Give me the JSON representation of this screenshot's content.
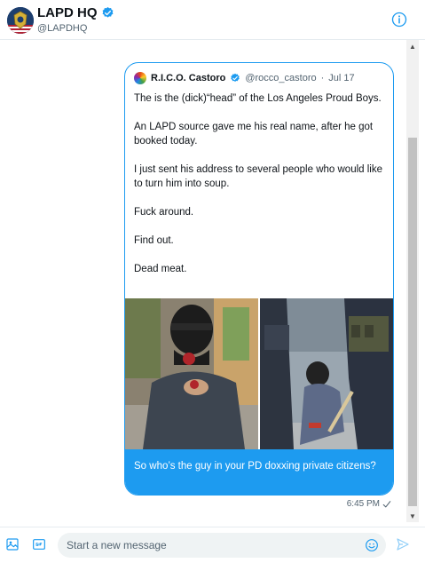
{
  "header": {
    "name": "LAPD HQ",
    "handle": "@LAPDHQ"
  },
  "quoted_tweet": {
    "author_name": "R.I.C.O. Castoro",
    "author_handle": "@rocco_castoro",
    "separator": "·",
    "date": "Jul 17",
    "paragraphs": [
      "The is the (dick)“head” of the Los Angeles Proud Boys.",
      "An LAPD source gave me his real name, after he got booked today.",
      "I just sent his address to several people who would like to turn him into soup.",
      "Fuck around.",
      "Find out.",
      "Dead meat."
    ]
  },
  "message": {
    "text": "So who’s the guy in your PD doxxing private citizens?",
    "time": "6:45 PM",
    "status_icon": "checkmark-sent-icon"
  },
  "composer": {
    "placeholder": "Start a new message"
  },
  "icons": {
    "verified": "verified-badge-icon",
    "info": "info-icon",
    "media": "image-icon",
    "gif": "gif-icon",
    "emoji": "emoji-icon",
    "send": "send-icon"
  },
  "colors": {
    "accent": "#1d9bf0",
    "text": "#0f1419",
    "muted": "#536471"
  }
}
